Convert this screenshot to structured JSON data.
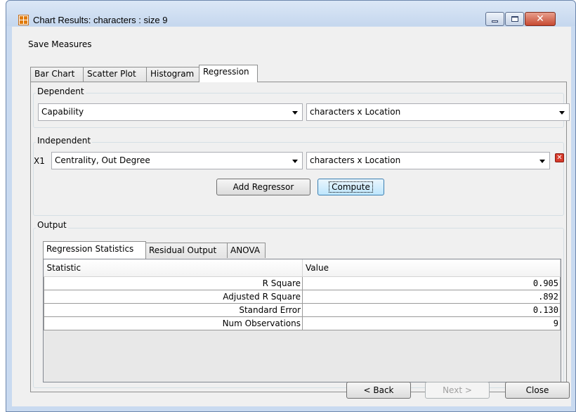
{
  "window": {
    "title": "Chart Results: characters : size 9",
    "controls": {
      "minimize": "minimize",
      "maximize": "maximize",
      "close": "close"
    }
  },
  "menu": {
    "save_measures": "Save Measures"
  },
  "tabs": [
    {
      "label": "Bar Chart",
      "active": false
    },
    {
      "label": "Scatter Plot",
      "active": false
    },
    {
      "label": "Histogram",
      "active": false
    },
    {
      "label": "Regression",
      "active": true
    }
  ],
  "dependent": {
    "label": "Dependent",
    "measure": "Capability",
    "network": "characters x Location"
  },
  "independent": {
    "label": "Independent",
    "regressors": [
      {
        "prefix": "X1",
        "measure": "Centrality, Out Degree",
        "network": "characters x Location"
      }
    ],
    "add_regressor": "Add Regressor",
    "compute": "Compute"
  },
  "output": {
    "label": "Output",
    "tabs": [
      {
        "label": "Regression Statistics",
        "active": true
      },
      {
        "label": "Residual Output",
        "active": false
      },
      {
        "label": "ANOVA",
        "active": false
      }
    ],
    "table": {
      "columns": [
        "Statistic",
        "Value"
      ],
      "rows": [
        [
          "R Square",
          "0.905"
        ],
        [
          "Adjusted R Square",
          ".892"
        ],
        [
          "Standard Error",
          "0.130"
        ],
        [
          "Num Observations",
          "9"
        ]
      ]
    }
  },
  "footer": {
    "back": "< Back",
    "next": "Next >",
    "close": "Close"
  },
  "icons": {
    "app": "network-grid-icon",
    "dropdown": "chevron-down-icon",
    "remove": "close-icon"
  }
}
